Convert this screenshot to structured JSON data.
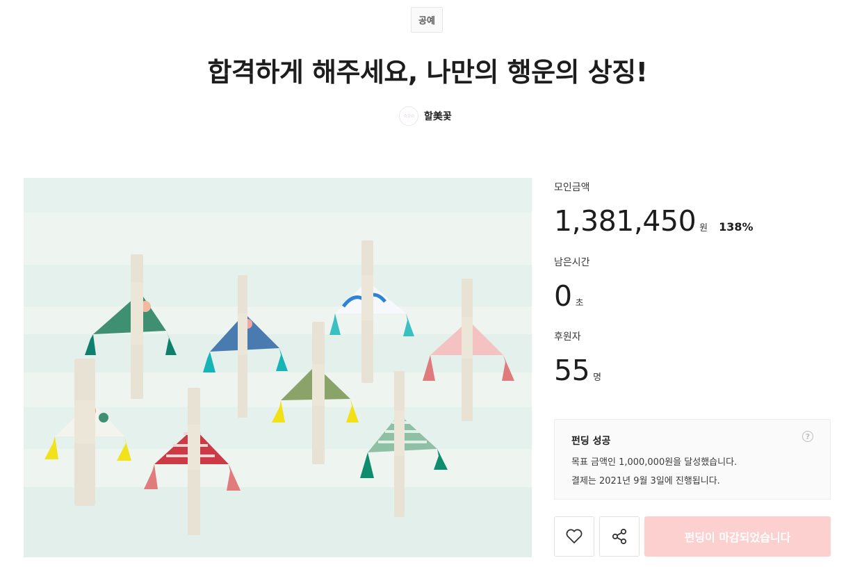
{
  "category": "공예",
  "title": "합격하게 해주세요, 나만의 행운의 상징!",
  "creator": {
    "avatar_text": "☆☆☆",
    "name": "할美꽃"
  },
  "stats": {
    "raised": {
      "label": "모인금액",
      "value": "1,381,450",
      "unit": "원",
      "rate": "138%"
    },
    "time_left": {
      "label": "남은시간",
      "value": "0",
      "unit": "초"
    },
    "backers": {
      "label": "후원자",
      "value": "55",
      "unit": "명"
    }
  },
  "notice": {
    "title": "펀딩 성공",
    "help": "?",
    "line1": "목표 금액인 1,000,000원을 달성했습니다.",
    "line2": "결제는 2021년 9월 3일에 진행됩니다."
  },
  "actions": {
    "like_icon": "heart-icon",
    "share_icon": "share-icon",
    "closed_label": "펀딩이 마감되었습니다"
  },
  "colors": {
    "closed_button_bg": "#fdd0d0",
    "hero_background": "#eef5f1"
  }
}
